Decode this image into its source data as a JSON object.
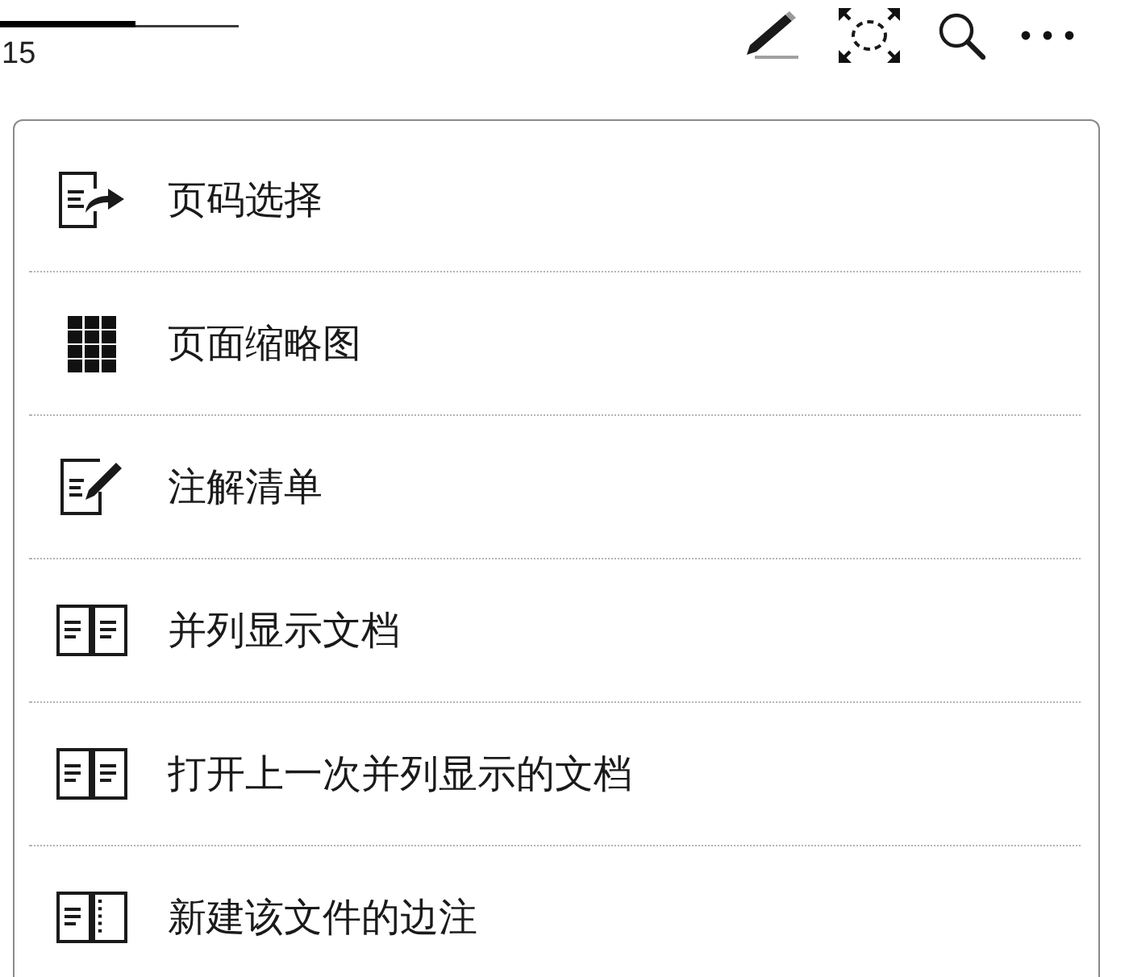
{
  "reader_bar": {
    "progress": {
      "level": 0.57
    },
    "page_number": "15"
  },
  "menu": {
    "items": [
      {
        "label": "页码选择"
      },
      {
        "label": "页面缩略图"
      },
      {
        "label": "注解清单"
      },
      {
        "label": "并列显示文档"
      },
      {
        "label": "打开上一次并列显示的文档"
      },
      {
        "label": "新建该文件的边注"
      }
    ]
  }
}
